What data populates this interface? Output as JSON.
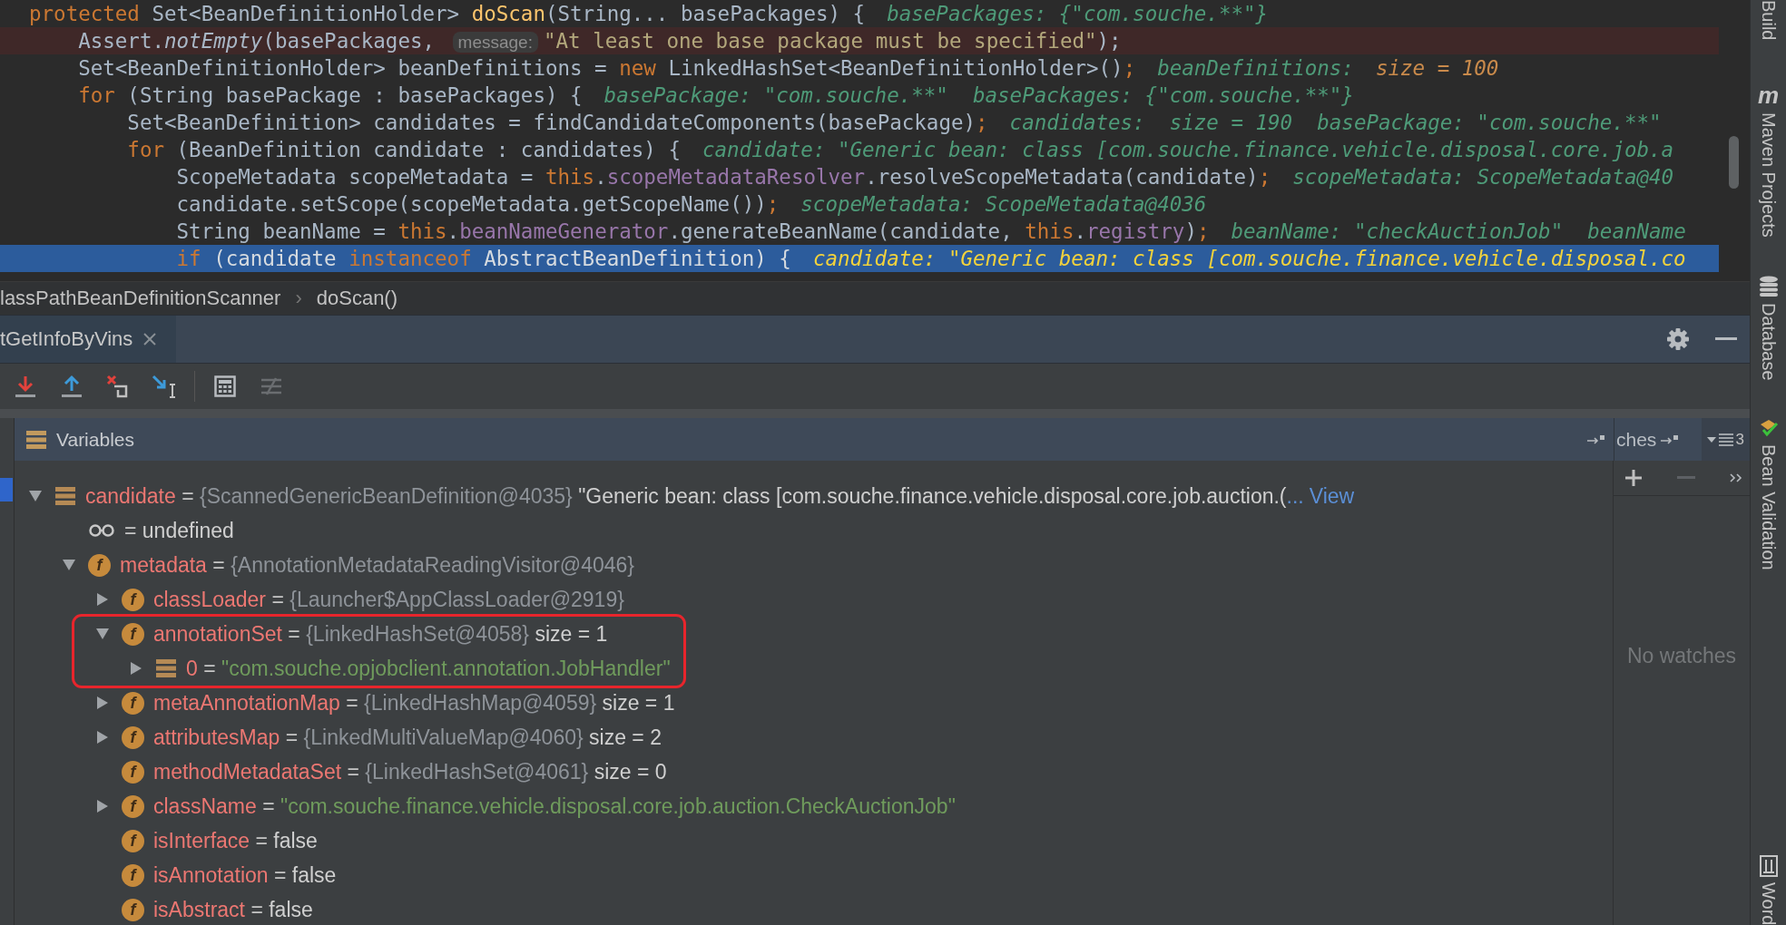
{
  "code": {
    "lines": [
      {
        "breakpoint": false,
        "current": false,
        "tokens": [
          {
            "kind": "kw",
            "text": "protected"
          },
          {
            "kind": "plain",
            "text": " Set<BeanDefinitionHolder> "
          },
          {
            "kind": "method",
            "text": "doScan"
          },
          {
            "kind": "plain",
            "text": "(String... basePackages) {"
          },
          {
            "kind": "hint",
            "text": "basePackages: {\"com.souche.**\"}"
          }
        ]
      },
      {
        "breakpoint": true,
        "current": false,
        "tokens": [
          {
            "kind": "plain",
            "text": "    Assert."
          },
          {
            "kind": "static",
            "text": "notEmpty"
          },
          {
            "kind": "plain",
            "text": "(basePackages, "
          },
          {
            "kind": "param",
            "text": "message:"
          },
          {
            "kind": "string",
            "text": "\"At least one base package must be specified\""
          },
          {
            "kind": "plain",
            "text": ");"
          }
        ]
      },
      {
        "breakpoint": false,
        "current": false,
        "tokens": [
          {
            "kind": "plain",
            "text": "    Set<BeanDefinitionHolder> beanDefinitions = "
          },
          {
            "kind": "kw",
            "text": "new"
          },
          {
            "kind": "plain",
            "text": " LinkedHashSet<BeanDefinitionHolder>()"
          },
          {
            "kind": "kw",
            "text": ";"
          },
          {
            "kind": "hint",
            "text": "beanDefinitions:"
          },
          {
            "kind": "hint_value",
            "text": "size = 100"
          }
        ]
      },
      {
        "breakpoint": false,
        "current": false,
        "tokens": [
          {
            "kind": "kw",
            "text": "    for"
          },
          {
            "kind": "plain",
            "text": " (String basePackage : basePackages) {"
          },
          {
            "kind": "hint",
            "text": "basePackage: \"com.souche.**\"  basePackages: {\"com.souche.**\"}"
          }
        ]
      },
      {
        "breakpoint": false,
        "current": false,
        "tokens": [
          {
            "kind": "plain",
            "text": "        Set<BeanDefinition> candidates = findCandidateComponents(basePackage)"
          },
          {
            "kind": "kw",
            "text": ";"
          },
          {
            "kind": "hint",
            "text": "candidates:  size = 190  basePackage: \"com.souche.**\""
          }
        ]
      },
      {
        "breakpoint": false,
        "current": false,
        "tokens": [
          {
            "kind": "kw",
            "text": "        for"
          },
          {
            "kind": "plain",
            "text": " (BeanDefinition candidate : candidates) {"
          },
          {
            "kind": "hint",
            "text": "candidate: \"Generic bean: class [com.souche.finance.vehicle.disposal.core.job.a"
          }
        ]
      },
      {
        "breakpoint": false,
        "current": false,
        "tokens": [
          {
            "kind": "plain",
            "text": "            ScopeMetadata scopeMetadata = "
          },
          {
            "kind": "kw",
            "text": "this"
          },
          {
            "kind": "plain",
            "text": "."
          },
          {
            "kind": "field",
            "text": "scopeMetadataResolver"
          },
          {
            "kind": "plain",
            "text": ".resolveScopeMetadata(candidate)"
          },
          {
            "kind": "kw",
            "text": ";"
          },
          {
            "kind": "hint",
            "text": "scopeMetadata: ScopeMetadata@40"
          }
        ]
      },
      {
        "breakpoint": false,
        "current": false,
        "tokens": [
          {
            "kind": "plain",
            "text": "            candidate.setScope(scopeMetadata.getScopeName())"
          },
          {
            "kind": "kw",
            "text": ";"
          },
          {
            "kind": "hint",
            "text": "scopeMetadata: ScopeMetadata@4036"
          }
        ]
      },
      {
        "breakpoint": false,
        "current": false,
        "tokens": [
          {
            "kind": "plain",
            "text": "            String beanName = "
          },
          {
            "kind": "kw",
            "text": "this"
          },
          {
            "kind": "plain",
            "text": "."
          },
          {
            "kind": "field",
            "text": "beanNameGenerator"
          },
          {
            "kind": "plain",
            "text": ".generateBeanName(candidate, "
          },
          {
            "kind": "kw",
            "text": "this"
          },
          {
            "kind": "plain",
            "text": "."
          },
          {
            "kind": "field",
            "text": "registry"
          },
          {
            "kind": "plain",
            "text": ")"
          },
          {
            "kind": "kw",
            "text": ";"
          },
          {
            "kind": "hint",
            "text": "beanName: \"checkAuctionJob\"  beanName"
          }
        ]
      },
      {
        "breakpoint": false,
        "current": true,
        "tokens": [
          {
            "kind": "kw",
            "text": "            if"
          },
          {
            "kind": "plain",
            "text": " (candidate "
          },
          {
            "kind": "kw",
            "text": "instanceof"
          },
          {
            "kind": "plain",
            "text": " AbstractBeanDefinition) {"
          },
          {
            "kind": "hint",
            "text": "candidate: \"Generic bean: class [com.souche.finance.vehicle.disposal.co"
          }
        ]
      }
    ]
  },
  "breadcrumbs": {
    "items": [
      "lassPathBeanDefinitionScanner",
      "doScan()"
    ],
    "separator": "›"
  },
  "debug_tab": {
    "label": "tGetInfoByVins"
  },
  "variables": {
    "title": "Variables",
    "tree": [
      {
        "kind": "object",
        "name": "candidate",
        "op": "=",
        "ref": "{ScannedGenericBeanDefinition@4035}",
        "expanded": true,
        "highlighted": false,
        "extra": "\"Generic bean: class [com.souche.finance.vehicle.disposal.core.job.auction.(",
        "ellipsis": "...",
        "link": "View",
        "children": [
          {
            "kind": "watch",
            "op": "=",
            "value": "undefined",
            "highlighted": false
          },
          {
            "kind": "field",
            "badge": "f",
            "name": "metadata",
            "op": "=",
            "ref": "{AnnotationMetadataReadingVisitor@4046}",
            "expanded": true,
            "highlighted": false,
            "children": [
              {
                "kind": "field",
                "badge": "f",
                "name": "classLoader",
                "op": "=",
                "ref": "{Launcher$AppClassLoader@2919}",
                "expanded": false,
                "highlighted": false
              },
              {
                "kind": "field",
                "badge": "f",
                "name": "annotationSet",
                "op": "=",
                "ref": "{LinkedHashSet@4058}",
                "size": "size = 1",
                "expanded": true,
                "highlighted": true,
                "children": [
                  {
                    "kind": "object",
                    "name": "0",
                    "op": "=",
                    "string": "\"com.souche.opjobclient.annotation.JobHandler\"",
                    "expanded": false,
                    "highlighted": false
                  }
                ]
              },
              {
                "kind": "field",
                "badge": "f",
                "name": "metaAnnotationMap",
                "op": "=",
                "ref": "{LinkedHashMap@4059}",
                "size": "size = 1",
                "expanded": false,
                "highlighted": false
              },
              {
                "kind": "field",
                "badge": "f",
                "name": "attributesMap",
                "op": "=",
                "ref": "{LinkedMultiValueMap@4060}",
                "size": "size = 2",
                "expanded": false,
                "highlighted": false
              },
              {
                "kind": "field",
                "badge": "f",
                "name": "methodMetadataSet",
                "op": "=",
                "ref": "{LinkedHashSet@4061}",
                "size": "size = 0",
                "highlighted": false
              },
              {
                "kind": "field",
                "badge": "f",
                "name": "className",
                "op": "=",
                "string": "\"com.souche.finance.vehicle.disposal.core.job.auction.CheckAuctionJob\"",
                "expanded": false,
                "highlighted": false
              },
              {
                "kind": "field",
                "badge": "f",
                "name": "isInterface",
                "op": "=",
                "value": "false",
                "highlighted": false
              },
              {
                "kind": "field",
                "badge": "f",
                "name": "isAnnotation",
                "op": "=",
                "value": "false",
                "highlighted": false
              },
              {
                "kind": "field",
                "badge": "f",
                "name": "isAbstract",
                "op": "=",
                "value": "false",
                "highlighted": false
              }
            ]
          }
        ]
      }
    ]
  },
  "watches": {
    "header_label": "ches",
    "count": "3",
    "empty_text": "No watches"
  },
  "sidebar": {
    "items": [
      {
        "kind": "plain",
        "label": "Build"
      },
      {
        "kind": "maven",
        "label": "Maven Projects",
        "glyph": "m"
      },
      {
        "kind": "database",
        "label": "Database"
      },
      {
        "kind": "bean",
        "label": "Bean Validation"
      },
      {
        "kind": "word",
        "label": "Word"
      }
    ]
  }
}
